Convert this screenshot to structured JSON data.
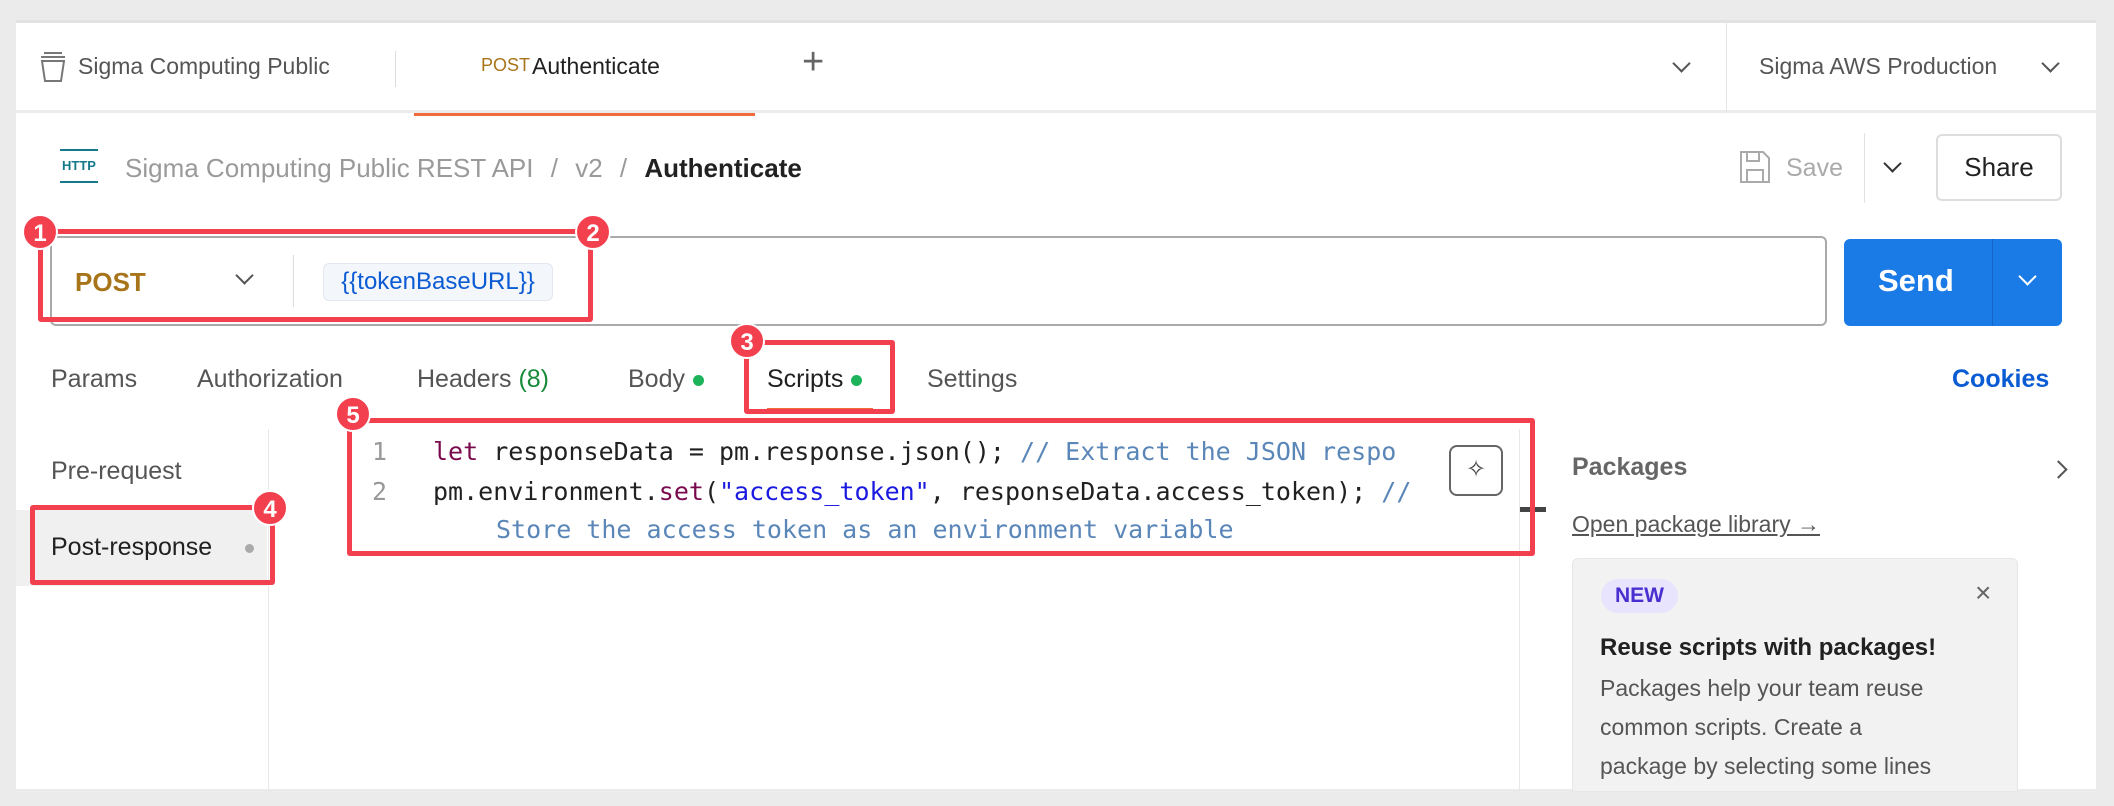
{
  "tabbar": {
    "workspace": "Sigma Computing Public",
    "active_tab": {
      "method": "POST",
      "name": "Authenticate"
    },
    "new_tab": "+",
    "environment": "Sigma AWS Production"
  },
  "breadcrumb": {
    "collection": "Sigma Computing Public REST API",
    "sep": "/",
    "folder": "v2",
    "request": "Authenticate",
    "icon_label": "HTTP"
  },
  "actions": {
    "save": "Save",
    "share": "Share"
  },
  "request": {
    "method": "POST",
    "url": "{{tokenBaseURL}}",
    "send": "Send"
  },
  "tabs": [
    {
      "label": "Params"
    },
    {
      "label": "Authorization"
    },
    {
      "label": "Headers",
      "count": "(8)"
    },
    {
      "label": "Body",
      "dot": true
    },
    {
      "label": "Scripts",
      "dot": true,
      "active": true
    },
    {
      "label": "Settings"
    }
  ],
  "cookies": "Cookies",
  "scripts_sidebar": [
    {
      "label": "Pre-request"
    },
    {
      "label": "Post-response",
      "active": true
    }
  ],
  "editor": {
    "line_numbers": [
      "1",
      "2"
    ],
    "line1": {
      "kw": "let",
      "code": " responseData = pm.response.json(); ",
      "comment": "// Extract the JSON respo"
    },
    "line2": {
      "pre": "pm.environment.",
      "fn": "set",
      "open": "(",
      "str": "\"access_token\"",
      "rest": ", responseData.access_token); ",
      "comment": "//"
    },
    "line2_wrap": "Store the access token as an environment variable"
  },
  "packages": {
    "title": "Packages",
    "link": "Open package library →",
    "card": {
      "badge": "NEW",
      "title": "Reuse scripts with packages!",
      "body": [
        "Packages help your team reuse",
        "common scripts. Create a",
        "package by selecting some lines"
      ]
    }
  },
  "annotations": [
    "1",
    "2",
    "3",
    "4",
    "5"
  ],
  "colors": {
    "accent": "#1a7ae6",
    "method": "#a8741a",
    "annotation": "#f3404f",
    "tab_underline": "#f26b3a",
    "link": "#0b5bd3"
  }
}
